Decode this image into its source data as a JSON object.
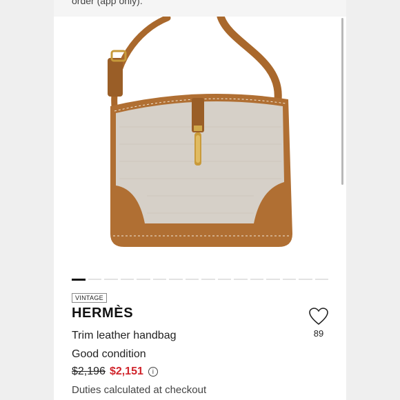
{
  "promo": {
    "text": "order (app only)."
  },
  "gallery": {
    "slide_count": 16,
    "active_index": 0
  },
  "product": {
    "badge": "VINTAGE",
    "brand": "HERMÈS",
    "title": "Trim leather handbag",
    "condition": "Good condition",
    "original_price": "$2,196",
    "sale_price": "$2,151",
    "duties_note": "Duties calculated at checkout"
  },
  "like": {
    "icon": "heart-icon",
    "count": "89"
  },
  "colors": {
    "sale": "#d0242b",
    "leather": "#b5763a",
    "canvas": "#d8d3cc"
  }
}
